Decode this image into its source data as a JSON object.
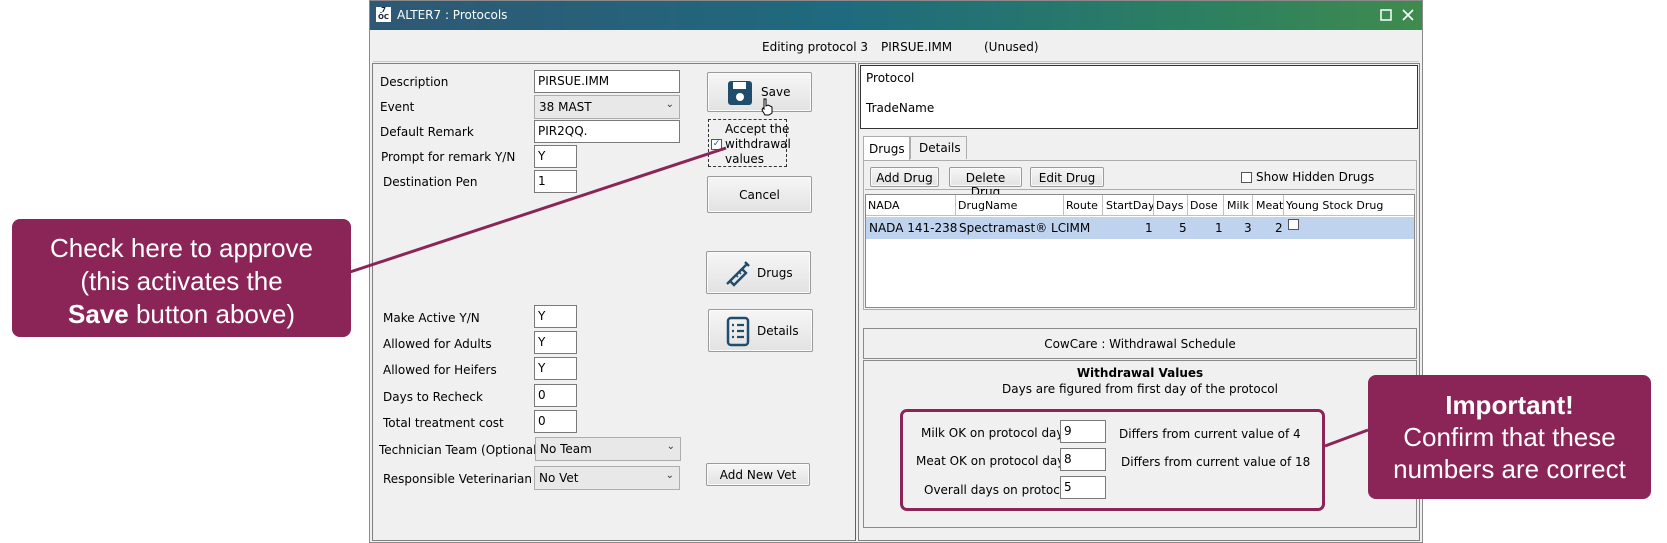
{
  "window": {
    "title": "ALTER7 : Protocols",
    "maximize_icon": "square",
    "close_icon": "x"
  },
  "header": {
    "editing_label": "Editing protocol 3",
    "protocol_name": "PIRSUE.IMM",
    "status": "(Unused)"
  },
  "form": {
    "description_label": "Description",
    "description_value": "PIRSUE.IMM",
    "event_label": "Event",
    "event_value": "38 MAST",
    "default_remark_label": "Default Remark",
    "default_remark_value": "PIR2QQ.",
    "prompt_remark_label": "Prompt for remark Y/N",
    "prompt_remark_value": "Y",
    "destination_pen_label": "Destination Pen",
    "destination_pen_value": "1",
    "make_active_label": "Make Active Y/N",
    "make_active_value": "Y",
    "allowed_adults_label": "Allowed for Adults",
    "allowed_adults_value": "Y",
    "allowed_heifers_label": "Allowed for Heifers",
    "allowed_heifers_value": "Y",
    "days_recheck_label": "Days to Recheck",
    "days_recheck_value": "0",
    "total_cost_label": "Total treatment cost",
    "total_cost_value": "0",
    "tech_team_label": "Technician Team (Optional)",
    "tech_team_value": "No Team",
    "vet_label": "Responsible Veterinarian",
    "vet_value": "No Vet"
  },
  "buttons": {
    "save": "Save",
    "accept_withdrawal_line1": "Accept the",
    "accept_withdrawal_line2": "withdrawal",
    "accept_withdrawal_line3": "values",
    "accept_checked": true,
    "cancel": "Cancel",
    "drugs": "Drugs",
    "details": "Details",
    "add_new_vet": "Add New Vet"
  },
  "right": {
    "protocol_label": "Protocol",
    "tradename_label": "TradeName",
    "tabs": [
      "Drugs",
      "Details"
    ],
    "active_tab": "Drugs",
    "add_drug": "Add Drug",
    "delete_drug": "Delete Drug",
    "edit_drug": "Edit Drug",
    "show_hidden": "Show Hidden Drugs",
    "columns": [
      "NADA",
      "DrugName",
      "Route",
      "StartDay",
      "Days",
      "Dose",
      "Milk",
      "Meat",
      "Young Stock Drug"
    ],
    "rows": [
      [
        "NADA 141-238",
        "Spectramast® LC",
        "IMM",
        "1",
        "5",
        "1",
        "3",
        "2",
        ""
      ]
    ],
    "schedule_title": "CowCare : Withdrawal Schedule",
    "withdrawal_heading": "Withdrawal Values",
    "withdrawal_sub": "Days are figured from first day of the protocol",
    "milk_ok_label": "Milk OK on protocol day",
    "milk_ok_value": "9",
    "milk_diff": "Differs from current value of 4",
    "meat_ok_label": "Meat OK on protocol day",
    "meat_ok_value": "8",
    "meat_diff": "Differs from current value of 18",
    "overall_label": "Overall days on protocol",
    "overall_value": "5"
  },
  "callouts": {
    "left_line1": "Check here to approve",
    "left_line2": "(this activates the",
    "left_line3_bold": "Save",
    "left_line3_rest": " button above)",
    "right_line1": "Important!",
    "right_line2": "Confirm that these",
    "right_line3": "numbers are correct"
  },
  "colors": {
    "callout": "#8b2457",
    "selected_row": "#bfd3ee"
  }
}
